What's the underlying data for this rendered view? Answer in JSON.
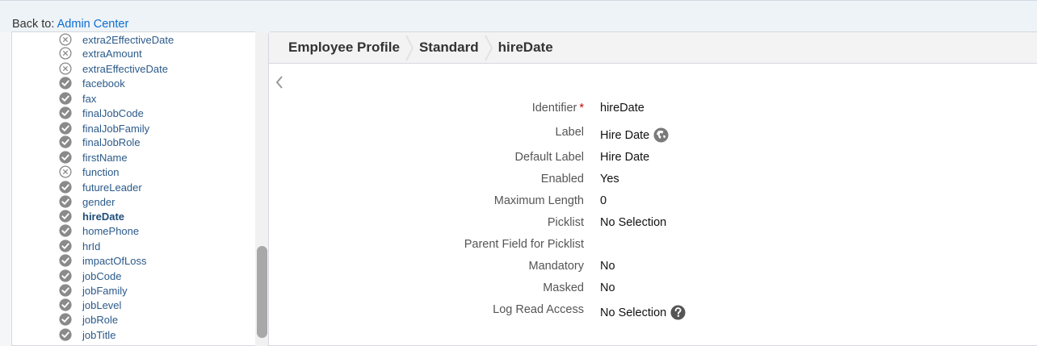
{
  "back": {
    "prefix": "Back to:",
    "link": "Admin Center"
  },
  "tree": {
    "items": [
      {
        "label": "extra2EffectiveDate",
        "status": "disabled"
      },
      {
        "label": "extraAmount",
        "status": "disabled"
      },
      {
        "label": "extraEffectiveDate",
        "status": "disabled"
      },
      {
        "label": "facebook",
        "status": "enabled"
      },
      {
        "label": "fax",
        "status": "enabled"
      },
      {
        "label": "finalJobCode",
        "status": "enabled"
      },
      {
        "label": "finalJobFamily",
        "status": "enabled"
      },
      {
        "label": "finalJobRole",
        "status": "enabled"
      },
      {
        "label": "firstName",
        "status": "enabled"
      },
      {
        "label": "function",
        "status": "disabled"
      },
      {
        "label": "futureLeader",
        "status": "enabled"
      },
      {
        "label": "gender",
        "status": "enabled"
      },
      {
        "label": "hireDate",
        "status": "enabled",
        "selected": true
      },
      {
        "label": "homePhone",
        "status": "enabled"
      },
      {
        "label": "hrId",
        "status": "enabled"
      },
      {
        "label": "impactOfLoss",
        "status": "enabled"
      },
      {
        "label": "jobCode",
        "status": "enabled"
      },
      {
        "label": "jobFamily",
        "status": "enabled"
      },
      {
        "label": "jobLevel",
        "status": "enabled"
      },
      {
        "label": "jobRole",
        "status": "enabled"
      },
      {
        "label": "jobTitle",
        "status": "enabled"
      }
    ]
  },
  "breadcrumb": [
    "Employee Profile",
    "Standard",
    "hireDate"
  ],
  "fields": {
    "identifier": {
      "key": "Identifier",
      "required_mark": "*",
      "value": "hireDate"
    },
    "label": {
      "key": "Label",
      "value": "Hire Date"
    },
    "default_label": {
      "key": "Default Label",
      "value": "Hire Date"
    },
    "enabled": {
      "key": "Enabled",
      "value": "Yes"
    },
    "max_length": {
      "key": "Maximum Length",
      "value": "0"
    },
    "picklist": {
      "key": "Picklist",
      "value": "No Selection"
    },
    "parent_picklist": {
      "key": "Parent Field for Picklist",
      "value": ""
    },
    "mandatory": {
      "key": "Mandatory",
      "value": "No"
    },
    "masked": {
      "key": "Masked",
      "value": "No"
    },
    "log_read_access": {
      "key": "Log Read Access",
      "value": "No Selection"
    }
  },
  "colors": {
    "link": "#0a6ed1",
    "icon_gray": "#8a8a8a",
    "required": "#cc0000"
  },
  "icons": {
    "enabled": "check-circle-icon",
    "disabled": "x-circle-icon",
    "translate": "globe-icon",
    "help": "help-icon",
    "back": "chevron-left-icon"
  }
}
